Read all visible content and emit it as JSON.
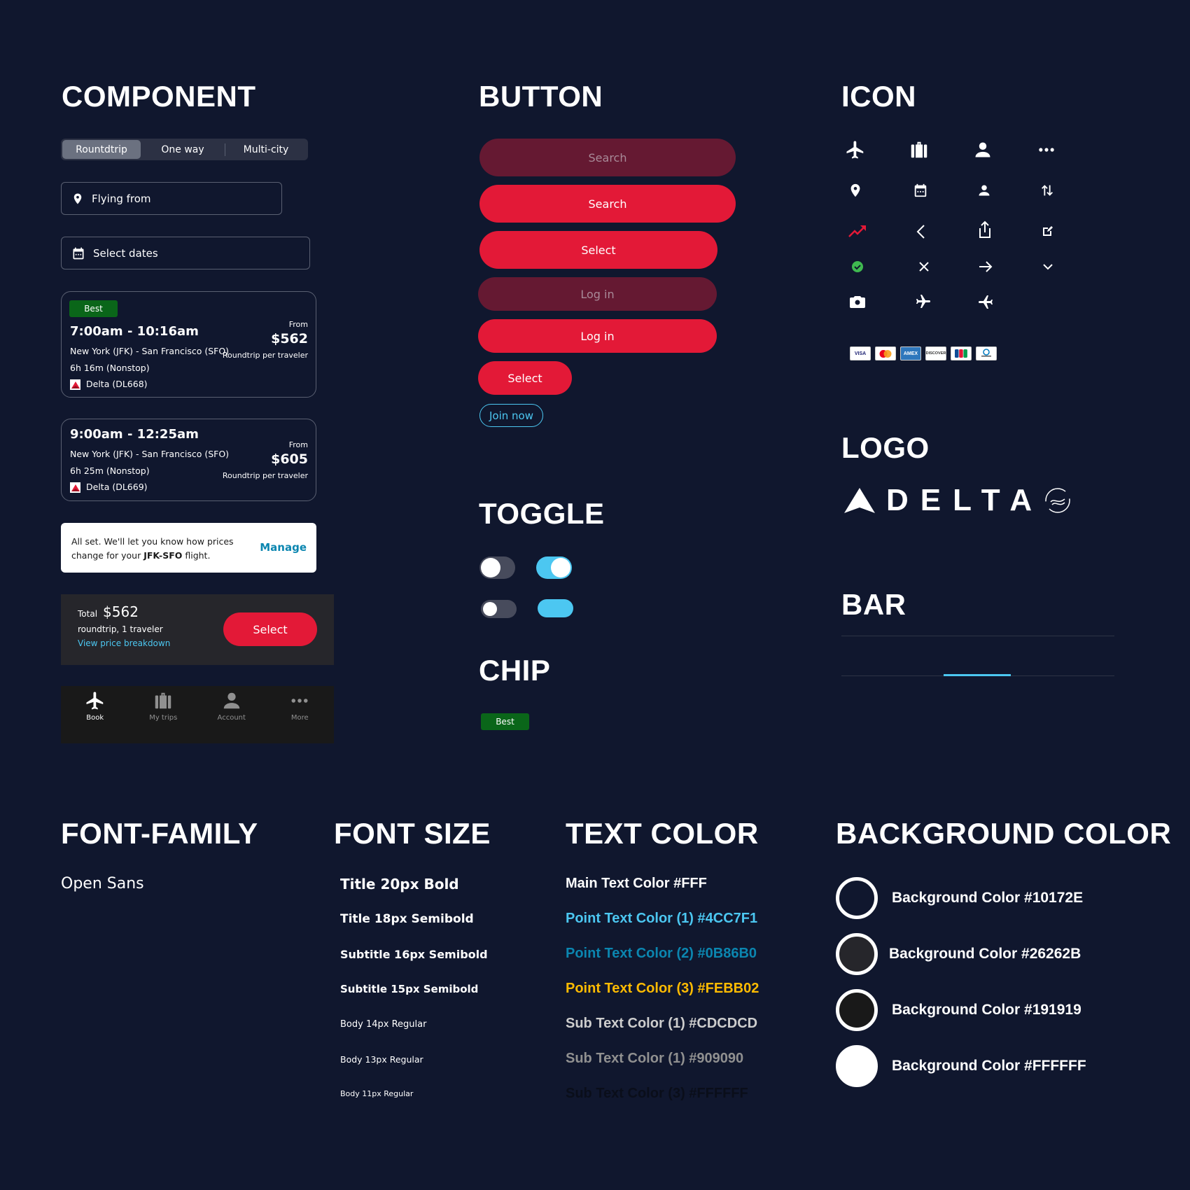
{
  "headings": {
    "component": "COMPONENT",
    "button": "BUTTON",
    "icon": "ICON",
    "logo": "LOGO",
    "bar": "BAR",
    "toggle": "TOGGLE",
    "chip": "CHIP",
    "font_family": "FONT-FAMILY",
    "font_size": "FONT SIZE",
    "text_color": "TEXT COLOR",
    "background_color": "BACKGROUND COLOR"
  },
  "component": {
    "trip_types": [
      {
        "label": "Rountdtrip",
        "active": true
      },
      {
        "label": "One way",
        "active": false
      },
      {
        "label": "Multi-city",
        "active": false
      }
    ],
    "flying_from_placeholder": "Flying from",
    "select_dates_placeholder": "Select dates",
    "flights": [
      {
        "badge": "Best",
        "time": "7:00am - 10:16am",
        "route": "New York (JFK) - San Francisco (SFO)",
        "duration": "6h 16m (Nonstop)",
        "airline": "Delta (DL668)",
        "from_label": "From",
        "price": "$562",
        "price_note": "Roundtrip per traveler"
      },
      {
        "badge": null,
        "time": "9:00am - 12:25am",
        "route": "New York (JFK) - San Francisco (SFO)",
        "duration": "6h 25m (Nonstop)",
        "airline": "Delta (DL669)",
        "from_label": "From",
        "price": "$605",
        "price_note": "Roundtrip per traveler"
      }
    ],
    "alert": {
      "text_part1": "All set. We'll let you know how prices",
      "text_part2": "change for your ",
      "route_bold": "JFK-SFO",
      "text_part3": " flight.",
      "action": "Manage"
    },
    "total_bar": {
      "total_label": "Total",
      "total_price": "$562",
      "trip_info": "roundtrip, 1 traveler",
      "breakdown_link": "View price breakdown",
      "select_label": "Select"
    },
    "bottom_nav": [
      {
        "label": "Book",
        "icon": "airplane-icon",
        "active": true
      },
      {
        "label": "My trips",
        "icon": "suitcase-icon",
        "active": false
      },
      {
        "label": "Account",
        "icon": "person-icon",
        "active": false
      },
      {
        "label": "More",
        "icon": "more-dots-icon",
        "active": false
      }
    ]
  },
  "buttons": {
    "search_disabled": "Search",
    "search": "Search",
    "select_medium": "Select",
    "login_disabled": "Log in",
    "login": "Log in",
    "select_small": "Select",
    "join_now": "Join now"
  },
  "toggles": [
    {
      "state": "off",
      "size": "large"
    },
    {
      "state": "on",
      "size": "large"
    },
    {
      "state": "off",
      "size": "small"
    },
    {
      "state": "on",
      "size": "small"
    }
  ],
  "chip": {
    "label": "Best"
  },
  "icons": [
    "airplane-icon",
    "suitcase-icon",
    "person-icon",
    "more-dots-icon",
    "location-pin-icon",
    "calendar-icon",
    "person-small-icon",
    "swap-vertical-icon",
    "trending-up-icon",
    "chevron-left-icon",
    "share-icon",
    "edit-icon",
    "check-circle-icon",
    "close-icon",
    "arrow-right-icon",
    "chevron-down-icon",
    "camera-icon",
    "departure-plane-icon",
    "arrival-plane-icon"
  ],
  "payment_cards": [
    "VISA",
    "Mastercard",
    "AMEX",
    "DISCOVER",
    "JCB",
    "Diners Club"
  ],
  "logo": {
    "wordmark": "DELTA",
    "alliance": "SKYTEAM"
  },
  "bar": {
    "active_start_fraction": 0.375,
    "active_end_fraction": 0.62
  },
  "font_family": {
    "name": "Open Sans"
  },
  "font_sizes": [
    "Title 20px Bold",
    "Title 18px Semibold",
    "Subtitle 16px Semibold",
    "Subtitle 15px Semibold",
    "Body 14px Regular",
    "Body 13px Regular",
    "Body 11px Regular"
  ],
  "text_colors": [
    {
      "label": "Main Text Color #FFF",
      "color": "#FFFFFF"
    },
    {
      "label": "Point Text Color (1) #4CC7F1",
      "color": "#4CC7F1"
    },
    {
      "label": "Point Text Color (2) #0B86B0",
      "color": "#0B86B0"
    },
    {
      "label": "Point Text Color (3) #FEBB02",
      "color": "#FEBB02"
    },
    {
      "label": "Sub Text Color (1) #CDCDCD",
      "color": "#CDCDCD"
    },
    {
      "label": "Sub Text Color (1) #909090",
      "color": "#909090"
    },
    {
      "label": "Sub Text Color (3) #FFFFFF",
      "color": "#0A0E1A"
    }
  ],
  "background_colors": [
    {
      "label": "Background Color #10172E",
      "color": "#10172E"
    },
    {
      "label": "Background Color #26262B",
      "color": "#26262B"
    },
    {
      "label": "Background Color #191919",
      "color": "#191919"
    },
    {
      "label": "Background Color #FFFFFF",
      "color": "#FFFFFF"
    }
  ],
  "colors": {
    "background": "#10172E",
    "primary_red": "#E31937",
    "disabled_red": "#651932",
    "accent_blue": "#4CC7F1",
    "link_blue": "#0B86B0",
    "chip_green": "#0A6619",
    "toggle_off": "#474B5C"
  }
}
